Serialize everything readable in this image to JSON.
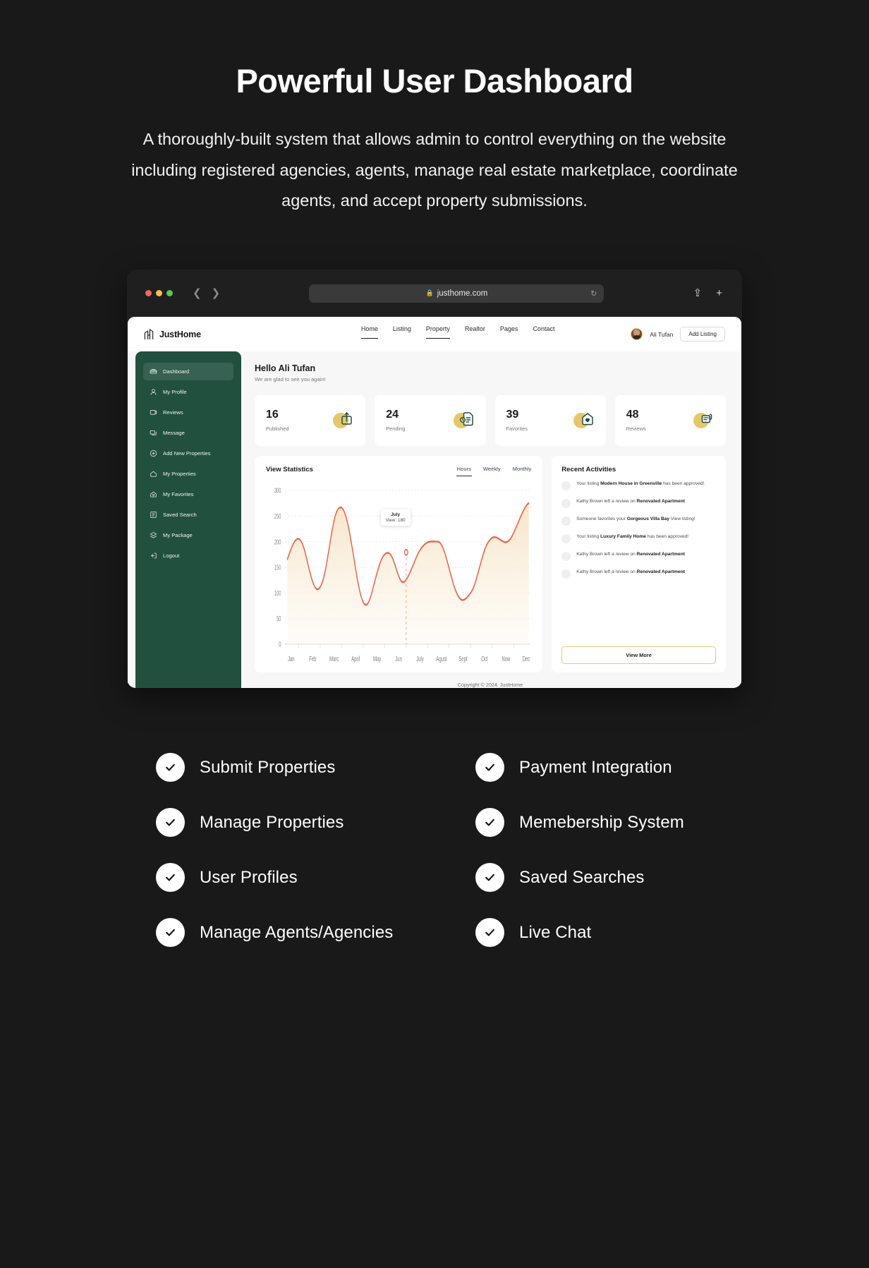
{
  "hero": {
    "title": "Powerful User Dashboard",
    "description": "A thoroughly-built system that allows admin to control everything on the website including registered agencies, agents, manage real estate marketplace, coordinate agents, and accept property submissions."
  },
  "browser": {
    "url": "justhome.com",
    "lock_icon": "lock-icon",
    "reload_icon": "reload-icon",
    "back_icon": "chevron-left-icon",
    "forward_icon": "chevron-right-icon",
    "share_icon": "share-icon",
    "new_tab_icon": "plus-icon"
  },
  "site_header": {
    "brand": "JustHome",
    "nav": [
      {
        "label": "Home",
        "active": false
      },
      {
        "label": "Listing",
        "active": false
      },
      {
        "label": "Property",
        "active": true
      },
      {
        "label": "Realtor",
        "active": false
      },
      {
        "label": "Pages",
        "active": false
      },
      {
        "label": "Contact",
        "active": false
      }
    ],
    "user_name": "Ali Tufan",
    "add_listing_label": "Add Listing"
  },
  "sidebar": {
    "items": [
      {
        "label": "Dashboard",
        "icon": "dashboard-icon",
        "active": true
      },
      {
        "label": "My Profile",
        "icon": "user-icon",
        "active": false
      },
      {
        "label": "Reviews",
        "icon": "review-icon",
        "active": false
      },
      {
        "label": "Message",
        "icon": "message-icon",
        "active": false
      },
      {
        "label": "Add New Properties",
        "icon": "plus-circle-icon",
        "active": false
      },
      {
        "label": "My Properties",
        "icon": "home-icon",
        "active": false
      },
      {
        "label": "My Favorites",
        "icon": "heart-home-icon",
        "active": false
      },
      {
        "label": "Saved Search",
        "icon": "saved-search-icon",
        "active": false
      },
      {
        "label": "My Package",
        "icon": "layers-icon",
        "active": false
      },
      {
        "label": "Logout",
        "icon": "logout-icon",
        "active": false
      }
    ]
  },
  "dashboard": {
    "greeting_title": "Hello Ali Tufan",
    "greeting_sub": "We are glad to see you again!",
    "stats": [
      {
        "value": "16",
        "label": "Published",
        "icon": "upload-box-icon"
      },
      {
        "value": "24",
        "label": "Pending",
        "icon": "pending-doc-icon"
      },
      {
        "value": "39",
        "label": "Favorites",
        "icon": "heart-home-icon"
      },
      {
        "value": "48",
        "label": "Reviews",
        "icon": "thumbs-up-icon"
      }
    ],
    "copyright": "Copyright © 2024. JustHome"
  },
  "view_statistics": {
    "title": "View Statistics",
    "tabs": [
      {
        "label": "Hours",
        "active": true
      },
      {
        "label": "Weekly",
        "active": false
      },
      {
        "label": "Monthly",
        "active": false
      }
    ],
    "tooltip": {
      "title": "July",
      "value": "View: 180"
    }
  },
  "chart_data": {
    "type": "area",
    "title": "View Statistics",
    "xlabel": "",
    "ylabel": "",
    "ylim": [
      0,
      300
    ],
    "yticks": [
      0,
      50,
      100,
      150,
      200,
      250,
      300
    ],
    "grid": true,
    "legend": false,
    "categories": [
      "Jan",
      "Feb",
      "Marc",
      "April",
      "May",
      "Jun",
      "July",
      "Agust",
      "Sept",
      "Oct",
      "Now",
      "Dec"
    ],
    "series": [
      {
        "name": "Views",
        "color": "#E8664B",
        "fill": "#FBF1E2",
        "values": [
          168,
          120,
          220,
          103,
          178,
          138,
          190,
          200,
          110,
          200,
          178,
          250
        ]
      }
    ],
    "annotations": [
      {
        "x": "July",
        "label": "July",
        "value": 180,
        "text": "View: 180"
      }
    ]
  },
  "recent_activities": {
    "title": "Recent Activities",
    "items": [
      {
        "prefix": "Your listing ",
        "strong": "Modern House in Greenville",
        "suffix": " has been approved!."
      },
      {
        "prefix": "Kathy Brown left a review on ",
        "strong": "Renovated Apartment",
        "suffix": ""
      },
      {
        "prefix": "Someone favorites your ",
        "strong": "Gorgeous Villa Bay",
        "suffix": " View listing!"
      },
      {
        "prefix": "Your listing ",
        "strong": "Luxury Family Home",
        "suffix": " has been approved!"
      },
      {
        "prefix": "Kathy Brown left a review on ",
        "strong": "Renovated Apartment",
        "suffix": ""
      },
      {
        "prefix": "Kathy Brown left a review on ",
        "strong": "Renovated Apartment",
        "suffix": ""
      }
    ],
    "view_more_label": "View More"
  },
  "features": [
    {
      "label": "Submit Properties",
      "column": "left"
    },
    {
      "label": "Payment Integration",
      "column": "right"
    },
    {
      "label": "Manage Properties",
      "column": "left"
    },
    {
      "label": "Memebership System",
      "column": "right"
    },
    {
      "label": "User Profiles",
      "column": "left"
    },
    {
      "label": "Saved Searches",
      "column": "right"
    },
    {
      "label": "Manage Agents/Agencies",
      "column": "left"
    },
    {
      "label": "Live Chat",
      "column": "right"
    }
  ],
  "colors": {
    "background": "#191919",
    "sidebar": "#21503F",
    "accent_gold": "#E5C76B",
    "chart_line": "#E8664B",
    "chart_fill": "#FBF1E2"
  }
}
